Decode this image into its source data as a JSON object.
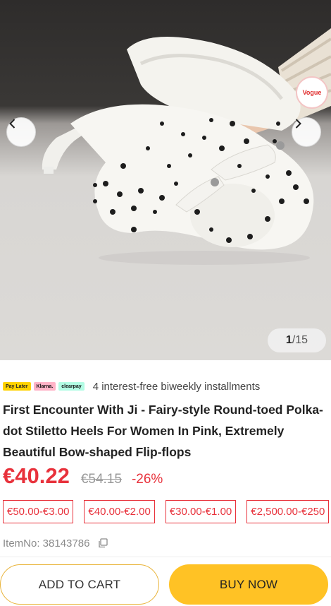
{
  "gallery": {
    "current": "1",
    "total": "/15",
    "badge_text": "Vogue"
  },
  "icons": {
    "prev": "chevron-left-icon",
    "next": "chevron-right-icon",
    "copy": "copy-icon"
  },
  "payment": {
    "logos": [
      "Pay Later",
      "Klarna.",
      "clearpay"
    ],
    "text": "4 interest-free biweekly installments"
  },
  "product": {
    "title": "First Encounter With Ji - Fairy-style Round-toed Polka-dot Stiletto Heels For Women In Pink, Extremely Beautiful Bow-shaped Flip-flops",
    "price": "€40.22",
    "original_price": "€54.15",
    "discount": "-26%",
    "item_no_label": "ItemNo: 38143786"
  },
  "coupons": [
    "€50.00-€3.00",
    "€40.00-€2.00",
    "€30.00-€1.00",
    "€2,500.00-€250"
  ],
  "actions": {
    "add_to_cart": "ADD TO CART",
    "buy_now": "BUY NOW"
  },
  "colors": {
    "price": "#e8323c",
    "buy_button": "#ffc225",
    "cart_border": "#e9b43a"
  }
}
